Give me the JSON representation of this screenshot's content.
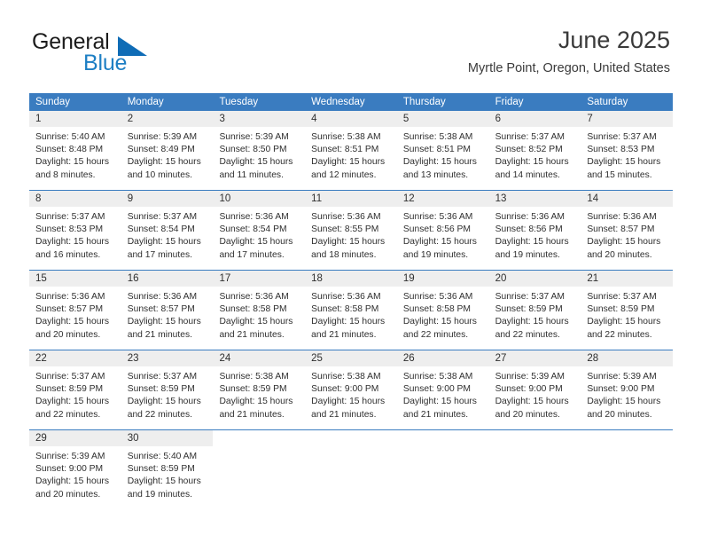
{
  "brand": {
    "word_top": "General",
    "word_bottom": "Blue",
    "triangle_color": "#0f6cb6",
    "blue_text_color": "#1e7fc4"
  },
  "header": {
    "title": "June 2025",
    "subtitle": "Myrtle Point, Oregon, United States"
  },
  "theme": {
    "header_blue": "#3a7cc0",
    "day_band_gray": "#eeeeee",
    "text_color": "#2f2f2f"
  },
  "weekdays": [
    "Sunday",
    "Monday",
    "Tuesday",
    "Wednesday",
    "Thursday",
    "Friday",
    "Saturday"
  ],
  "labels": {
    "sunrise_prefix": "Sunrise:",
    "sunset_prefix": "Sunset:",
    "daylight_prefix": "Daylight:"
  },
  "weeks": [
    [
      {
        "day": "1",
        "sunrise": "Sunrise: 5:40 AM",
        "sunset": "Sunset: 8:48 PM",
        "daylight_line1": "Daylight: 15 hours",
        "daylight_line2": "and 8 minutes."
      },
      {
        "day": "2",
        "sunrise": "Sunrise: 5:39 AM",
        "sunset": "Sunset: 8:49 PM",
        "daylight_line1": "Daylight: 15 hours",
        "daylight_line2": "and 10 minutes."
      },
      {
        "day": "3",
        "sunrise": "Sunrise: 5:39 AM",
        "sunset": "Sunset: 8:50 PM",
        "daylight_line1": "Daylight: 15 hours",
        "daylight_line2": "and 11 minutes."
      },
      {
        "day": "4",
        "sunrise": "Sunrise: 5:38 AM",
        "sunset": "Sunset: 8:51 PM",
        "daylight_line1": "Daylight: 15 hours",
        "daylight_line2": "and 12 minutes."
      },
      {
        "day": "5",
        "sunrise": "Sunrise: 5:38 AM",
        "sunset": "Sunset: 8:51 PM",
        "daylight_line1": "Daylight: 15 hours",
        "daylight_line2": "and 13 minutes."
      },
      {
        "day": "6",
        "sunrise": "Sunrise: 5:37 AM",
        "sunset": "Sunset: 8:52 PM",
        "daylight_line1": "Daylight: 15 hours",
        "daylight_line2": "and 14 minutes."
      },
      {
        "day": "7",
        "sunrise": "Sunrise: 5:37 AM",
        "sunset": "Sunset: 8:53 PM",
        "daylight_line1": "Daylight: 15 hours",
        "daylight_line2": "and 15 minutes."
      }
    ],
    [
      {
        "day": "8",
        "sunrise": "Sunrise: 5:37 AM",
        "sunset": "Sunset: 8:53 PM",
        "daylight_line1": "Daylight: 15 hours",
        "daylight_line2": "and 16 minutes."
      },
      {
        "day": "9",
        "sunrise": "Sunrise: 5:37 AM",
        "sunset": "Sunset: 8:54 PM",
        "daylight_line1": "Daylight: 15 hours",
        "daylight_line2": "and 17 minutes."
      },
      {
        "day": "10",
        "sunrise": "Sunrise: 5:36 AM",
        "sunset": "Sunset: 8:54 PM",
        "daylight_line1": "Daylight: 15 hours",
        "daylight_line2": "and 17 minutes."
      },
      {
        "day": "11",
        "sunrise": "Sunrise: 5:36 AM",
        "sunset": "Sunset: 8:55 PM",
        "daylight_line1": "Daylight: 15 hours",
        "daylight_line2": "and 18 minutes."
      },
      {
        "day": "12",
        "sunrise": "Sunrise: 5:36 AM",
        "sunset": "Sunset: 8:56 PM",
        "daylight_line1": "Daylight: 15 hours",
        "daylight_line2": "and 19 minutes."
      },
      {
        "day": "13",
        "sunrise": "Sunrise: 5:36 AM",
        "sunset": "Sunset: 8:56 PM",
        "daylight_line1": "Daylight: 15 hours",
        "daylight_line2": "and 19 minutes."
      },
      {
        "day": "14",
        "sunrise": "Sunrise: 5:36 AM",
        "sunset": "Sunset: 8:57 PM",
        "daylight_line1": "Daylight: 15 hours",
        "daylight_line2": "and 20 minutes."
      }
    ],
    [
      {
        "day": "15",
        "sunrise": "Sunrise: 5:36 AM",
        "sunset": "Sunset: 8:57 PM",
        "daylight_line1": "Daylight: 15 hours",
        "daylight_line2": "and 20 minutes."
      },
      {
        "day": "16",
        "sunrise": "Sunrise: 5:36 AM",
        "sunset": "Sunset: 8:57 PM",
        "daylight_line1": "Daylight: 15 hours",
        "daylight_line2": "and 21 minutes."
      },
      {
        "day": "17",
        "sunrise": "Sunrise: 5:36 AM",
        "sunset": "Sunset: 8:58 PM",
        "daylight_line1": "Daylight: 15 hours",
        "daylight_line2": "and 21 minutes."
      },
      {
        "day": "18",
        "sunrise": "Sunrise: 5:36 AM",
        "sunset": "Sunset: 8:58 PM",
        "daylight_line1": "Daylight: 15 hours",
        "daylight_line2": "and 21 minutes."
      },
      {
        "day": "19",
        "sunrise": "Sunrise: 5:36 AM",
        "sunset": "Sunset: 8:58 PM",
        "daylight_line1": "Daylight: 15 hours",
        "daylight_line2": "and 22 minutes."
      },
      {
        "day": "20",
        "sunrise": "Sunrise: 5:37 AM",
        "sunset": "Sunset: 8:59 PM",
        "daylight_line1": "Daylight: 15 hours",
        "daylight_line2": "and 22 minutes."
      },
      {
        "day": "21",
        "sunrise": "Sunrise: 5:37 AM",
        "sunset": "Sunset: 8:59 PM",
        "daylight_line1": "Daylight: 15 hours",
        "daylight_line2": "and 22 minutes."
      }
    ],
    [
      {
        "day": "22",
        "sunrise": "Sunrise: 5:37 AM",
        "sunset": "Sunset: 8:59 PM",
        "daylight_line1": "Daylight: 15 hours",
        "daylight_line2": "and 22 minutes."
      },
      {
        "day": "23",
        "sunrise": "Sunrise: 5:37 AM",
        "sunset": "Sunset: 8:59 PM",
        "daylight_line1": "Daylight: 15 hours",
        "daylight_line2": "and 22 minutes."
      },
      {
        "day": "24",
        "sunrise": "Sunrise: 5:38 AM",
        "sunset": "Sunset: 8:59 PM",
        "daylight_line1": "Daylight: 15 hours",
        "daylight_line2": "and 21 minutes."
      },
      {
        "day": "25",
        "sunrise": "Sunrise: 5:38 AM",
        "sunset": "Sunset: 9:00 PM",
        "daylight_line1": "Daylight: 15 hours",
        "daylight_line2": "and 21 minutes."
      },
      {
        "day": "26",
        "sunrise": "Sunrise: 5:38 AM",
        "sunset": "Sunset: 9:00 PM",
        "daylight_line1": "Daylight: 15 hours",
        "daylight_line2": "and 21 minutes."
      },
      {
        "day": "27",
        "sunrise": "Sunrise: 5:39 AM",
        "sunset": "Sunset: 9:00 PM",
        "daylight_line1": "Daylight: 15 hours",
        "daylight_line2": "and 20 minutes."
      },
      {
        "day": "28",
        "sunrise": "Sunrise: 5:39 AM",
        "sunset": "Sunset: 9:00 PM",
        "daylight_line1": "Daylight: 15 hours",
        "daylight_line2": "and 20 minutes."
      }
    ],
    [
      {
        "day": "29",
        "sunrise": "Sunrise: 5:39 AM",
        "sunset": "Sunset: 9:00 PM",
        "daylight_line1": "Daylight: 15 hours",
        "daylight_line2": "and 20 minutes."
      },
      {
        "day": "30",
        "sunrise": "Sunrise: 5:40 AM",
        "sunset": "Sunset: 8:59 PM",
        "daylight_line1": "Daylight: 15 hours",
        "daylight_line2": "and 19 minutes."
      },
      {
        "day": "",
        "sunrise": "",
        "sunset": "",
        "daylight_line1": "",
        "daylight_line2": ""
      },
      {
        "day": "",
        "sunrise": "",
        "sunset": "",
        "daylight_line1": "",
        "daylight_line2": ""
      },
      {
        "day": "",
        "sunrise": "",
        "sunset": "",
        "daylight_line1": "",
        "daylight_line2": ""
      },
      {
        "day": "",
        "sunrise": "",
        "sunset": "",
        "daylight_line1": "",
        "daylight_line2": ""
      },
      {
        "day": "",
        "sunrise": "",
        "sunset": "",
        "daylight_line1": "",
        "daylight_line2": ""
      }
    ]
  ]
}
